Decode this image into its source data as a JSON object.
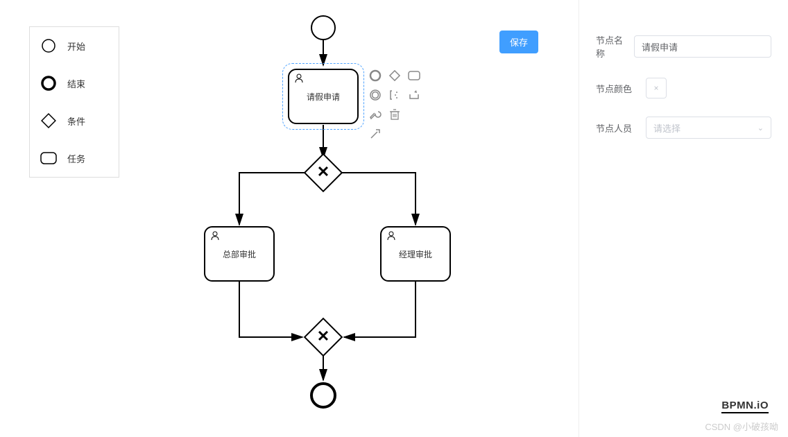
{
  "palette": {
    "items": [
      {
        "label": "开始",
        "icon": "start-event-icon"
      },
      {
        "label": "结束",
        "icon": "end-event-icon"
      },
      {
        "label": "条件",
        "icon": "gateway-icon"
      },
      {
        "label": "任务",
        "icon": "task-icon"
      }
    ]
  },
  "toolbar": {
    "save_label": "保存"
  },
  "diagram": {
    "selected_task_label": "请假申请",
    "task_left_label": "总部审批",
    "task_right_label": "经理审批"
  },
  "properties": {
    "name_label": "节点名称",
    "name_value": "请假申请",
    "color_label": "节点颜色",
    "color_clear": "×",
    "person_label": "节点人员",
    "person_placeholder": "请选择"
  },
  "branding": {
    "logo": "BPMN.iO"
  },
  "watermark": "CSDN @小破孩呦"
}
